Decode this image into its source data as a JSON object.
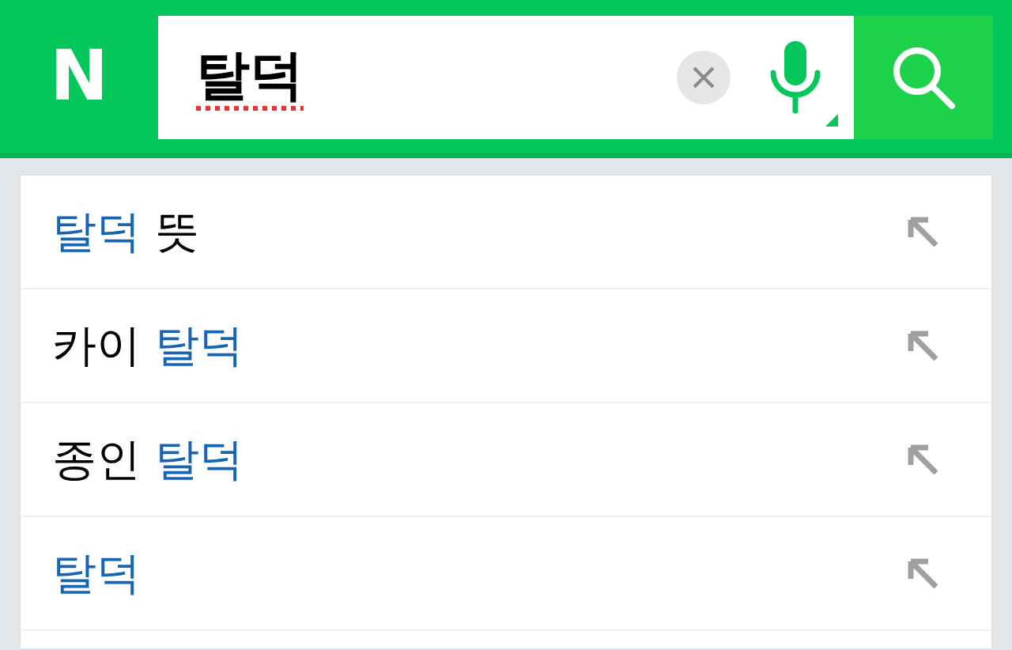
{
  "header": {
    "logo": "N",
    "query": "탈덕"
  },
  "suggestions": [
    {
      "parts": [
        {
          "text": "탈덕",
          "match": true
        },
        {
          "text": " 뜻",
          "match": false
        }
      ]
    },
    {
      "parts": [
        {
          "text": "카이 ",
          "match": false
        },
        {
          "text": "탈덕",
          "match": true
        }
      ]
    },
    {
      "parts": [
        {
          "text": "종인 ",
          "match": false
        },
        {
          "text": "탈덕",
          "match": true
        }
      ]
    },
    {
      "parts": [
        {
          "text": "탈덕",
          "match": true
        }
      ]
    }
  ]
}
